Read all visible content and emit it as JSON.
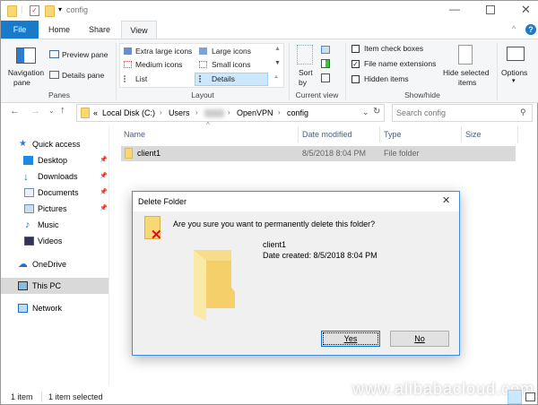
{
  "window": {
    "title": "config"
  },
  "tabs": [
    "File",
    "Home",
    "Share",
    "View"
  ],
  "ribbon": {
    "panes": {
      "navigation": "Navigation",
      "navigation2": "pane",
      "preview": "Preview pane",
      "details": "Details pane",
      "label": "Panes"
    },
    "layout": {
      "items": [
        "Extra large icons",
        "Large icons",
        "Medium icons",
        "Small icons",
        "List",
        "Details"
      ],
      "label": "Layout"
    },
    "current_view": {
      "sort": "Sort",
      "sort2": "by",
      "label": "Current view"
    },
    "show_hide": {
      "item_check_boxes": "Item check boxes",
      "file_name_extensions": "File name extensions",
      "hidden_items": "Hidden items",
      "hide_selected": "Hide selected",
      "hide_selected2": "items",
      "label": "Show/hide"
    },
    "options": "Options"
  },
  "address": {
    "crumbs": [
      "Local Disk (C:)",
      "Users",
      "OpenVPN",
      "config"
    ],
    "search_placeholder": "Search config"
  },
  "nav": {
    "items": [
      "Quick access",
      "Desktop",
      "Downloads",
      "Documents",
      "Pictures",
      "Music",
      "Videos",
      "OneDrive",
      "This PC",
      "Network"
    ]
  },
  "columns": [
    "Name",
    "Date modified",
    "Type",
    "Size"
  ],
  "files": [
    {
      "name": "client1",
      "date": "8/5/2018 8:04 PM",
      "type": "File folder"
    }
  ],
  "dialog": {
    "title": "Delete Folder",
    "question": "Are you sure you want to permanently delete this folder?",
    "name": "client1",
    "date_created": "Date created: 8/5/2018 8:04 PM",
    "yes": "Yes",
    "no": "No"
  },
  "status": {
    "count": "1 item",
    "selected": "1 item selected"
  },
  "watermark": "www.alibabacloud.com",
  "colors": {
    "file_tab": "#1979ca",
    "selection": "#cce8ff",
    "accent": "#3c8ee0"
  }
}
